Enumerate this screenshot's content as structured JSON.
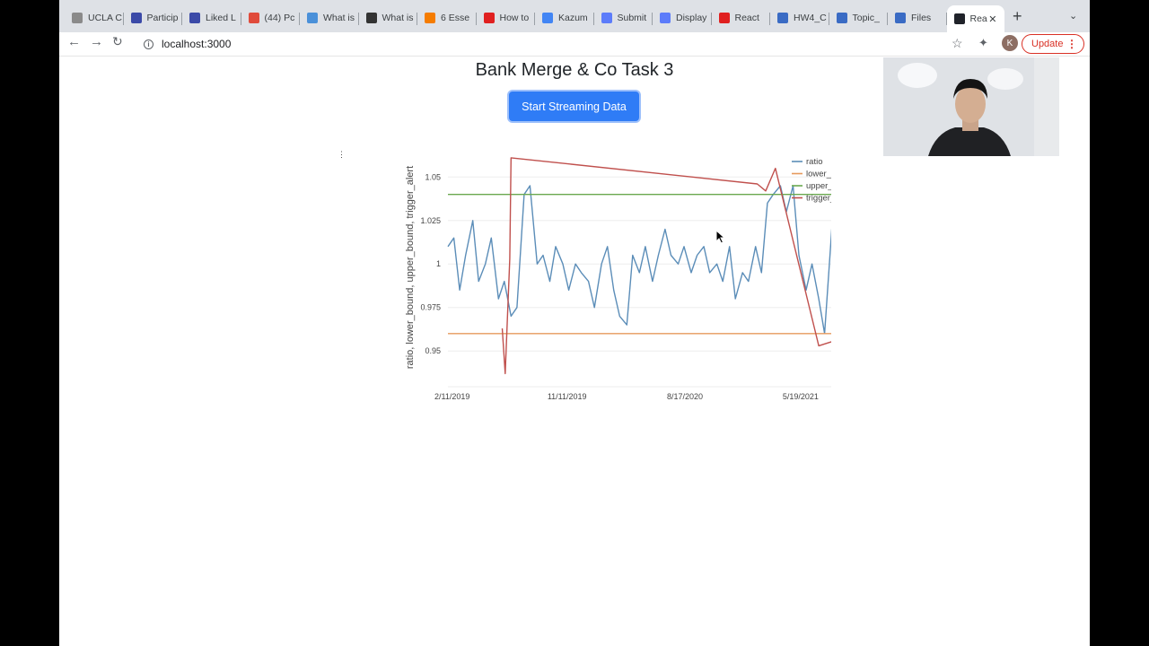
{
  "browser": {
    "tabs": [
      {
        "title": "UCLA C",
        "icon": "ucla-icon",
        "color": "#8a8a8a"
      },
      {
        "title": "Particip",
        "icon": "campuswire-icon",
        "color": "#3b4aa8"
      },
      {
        "title": "Liked L",
        "icon": "campuswire-icon",
        "color": "#3b4aa8"
      },
      {
        "title": "(44) Pc",
        "icon": "hackerrank-icon",
        "color": "#e04b3b"
      },
      {
        "title": "What is",
        "icon": "web-icon",
        "color": "#4a90d9"
      },
      {
        "title": "What is",
        "icon": "github-icon",
        "color": "#333333"
      },
      {
        "title": "6 Esse",
        "icon": "blogger-icon",
        "color": "#f57c00"
      },
      {
        "title": "How to",
        "icon": "youtube-icon",
        "color": "#e02020"
      },
      {
        "title": "Kazum",
        "icon": "docs-icon",
        "color": "#4285f4"
      },
      {
        "title": "Submit",
        "icon": "gem-icon",
        "color": "#5c7cfa"
      },
      {
        "title": "Display",
        "icon": "gem-icon",
        "color": "#5c7cfa"
      },
      {
        "title": "React",
        "icon": "youtube-icon",
        "color": "#e02020"
      },
      {
        "title": "HW4_C",
        "icon": "ucla-box-icon",
        "color": "#3a6bc4"
      },
      {
        "title": "Topic_",
        "icon": "ucla-box-icon",
        "color": "#3a6bc4"
      },
      {
        "title": "Files",
        "icon": "ucla-box-icon",
        "color": "#3a6bc4"
      },
      {
        "title": "Rea",
        "icon": "react-icon",
        "color": "#20232a",
        "active": true
      }
    ],
    "url": "localhost:3000",
    "update_label": "Update",
    "avatar_letter": "K"
  },
  "page": {
    "title": "Bank Merge & Co Task 3",
    "button_label": "Start Streaming Data"
  },
  "chart_data": {
    "type": "line",
    "ylabel": "ratio, lower_bound, upper_bound, trigger_alert",
    "x_ticks": [
      "2/11/2019",
      "11/11/2019",
      "8/17/2020",
      "5/19/2021"
    ],
    "y_ticks": [
      0.95,
      0.975,
      1,
      1.025,
      1.05
    ],
    "ylim": [
      0.93,
      1.062
    ],
    "xlim": [
      "2019-02-01",
      "2021-10-24"
    ],
    "legend_position": "top-right",
    "grid": true,
    "series": [
      {
        "name": "ratio",
        "color": "#5b8db8",
        "x": [
          "2019-02-01",
          "2019-02-15",
          "2019-03-01",
          "2019-03-15",
          "2019-04-01",
          "2019-04-15",
          "2019-05-01",
          "2019-05-15",
          "2019-06-01",
          "2019-06-15",
          "2019-07-01",
          "2019-07-15",
          "2019-08-01",
          "2019-08-15",
          "2019-09-01",
          "2019-09-15",
          "2019-10-01",
          "2019-10-15",
          "2019-11-01",
          "2019-11-15",
          "2019-12-01",
          "2019-12-15",
          "2020-01-01",
          "2020-01-15",
          "2020-02-01",
          "2020-02-15",
          "2020-03-01",
          "2020-03-15",
          "2020-04-01",
          "2020-04-15",
          "2020-05-01",
          "2020-05-15",
          "2020-06-01",
          "2020-06-15",
          "2020-07-01",
          "2020-07-15",
          "2020-08-01",
          "2020-08-15",
          "2020-09-01",
          "2020-09-15",
          "2020-10-01",
          "2020-10-15",
          "2020-11-01",
          "2020-11-15",
          "2020-12-01",
          "2020-12-15",
          "2021-01-01",
          "2021-01-15",
          "2021-02-01",
          "2021-02-15",
          "2021-03-01",
          "2021-03-15",
          "2021-04-01",
          "2021-04-15",
          "2021-05-01",
          "2021-05-15",
          "2021-06-01",
          "2021-06-15",
          "2021-07-01",
          "2021-07-15",
          "2021-08-01",
          "2021-08-15",
          "2021-09-01",
          "2021-09-15",
          "2021-10-01",
          "2021-10-15"
        ],
        "y": [
          1.01,
          1.015,
          0.985,
          1.005,
          1.025,
          0.99,
          1.0,
          1.015,
          0.98,
          0.99,
          0.97,
          0.975,
          1.04,
          1.045,
          1.0,
          1.005,
          0.99,
          1.01,
          1.0,
          0.985,
          1.0,
          0.995,
          0.99,
          0.975,
          1.0,
          1.01,
          0.985,
          0.97,
          0.965,
          1.005,
          0.995,
          1.01,
          0.99,
          1.005,
          1.02,
          1.005,
          1.0,
          1.01,
          0.995,
          1.005,
          1.01,
          0.995,
          1.0,
          0.99,
          1.01,
          0.98,
          0.995,
          0.99,
          1.01,
          0.995,
          1.035,
          1.04,
          1.045,
          1.03,
          1.045,
          1.005,
          0.985,
          1.0,
          0.98,
          0.96,
          1.02,
          1.015,
          1.01,
          0.995,
          1.035,
          0.975
        ]
      },
      {
        "name": "lower_bound",
        "color": "#e69a5c",
        "x": [
          "2019-02-01",
          "2021-10-24"
        ],
        "y": [
          0.96,
          0.96
        ]
      },
      {
        "name": "upper_bound",
        "color": "#6aa84f",
        "x": [
          "2019-02-01",
          "2021-10-24"
        ],
        "y": [
          1.04,
          1.04
        ]
      },
      {
        "name": "trigger_alert",
        "color": "#c0504d",
        "x": [
          "2019-06-10",
          "2019-06-17",
          "2019-06-28",
          "2019-07-01",
          "2021-02-05",
          "2021-02-25",
          "2021-03-20",
          "2021-07-01",
          "2021-09-30",
          "2021-10-24"
        ],
        "y": [
          0.963,
          0.937,
          1.003,
          1.061,
          1.046,
          1.042,
          1.055,
          0.953,
          0.96,
          0.96
        ]
      }
    ]
  }
}
